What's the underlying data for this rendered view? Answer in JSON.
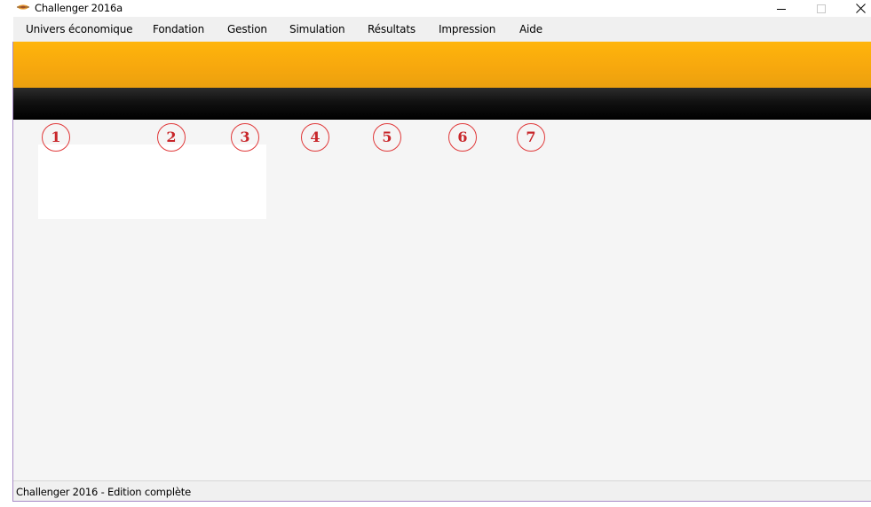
{
  "window": {
    "title": "Challenger 2016a",
    "icon": "challenger-app-icon",
    "controls": {
      "minimize": "minimize-icon",
      "maximize": "maximize-icon",
      "close": "close-icon"
    }
  },
  "menu": {
    "items": [
      {
        "label": "Univers économique"
      },
      {
        "label": "Fondation"
      },
      {
        "label": "Gestion"
      },
      {
        "label": "Simulation"
      },
      {
        "label": "Résultats"
      },
      {
        "label": "Impression"
      },
      {
        "label": "Aide"
      }
    ]
  },
  "colors": {
    "banner_orange": "#ffb50c",
    "banner_black": "#000000",
    "marker_red": "#e0393a",
    "main_background": "#f5f5f5"
  },
  "markers": [
    {
      "number": "1"
    },
    {
      "number": "2"
    },
    {
      "number": "3"
    },
    {
      "number": "4"
    },
    {
      "number": "5"
    },
    {
      "number": "6"
    },
    {
      "number": "7"
    }
  ],
  "status": {
    "text": "Challenger 2016 - Edition complète"
  }
}
